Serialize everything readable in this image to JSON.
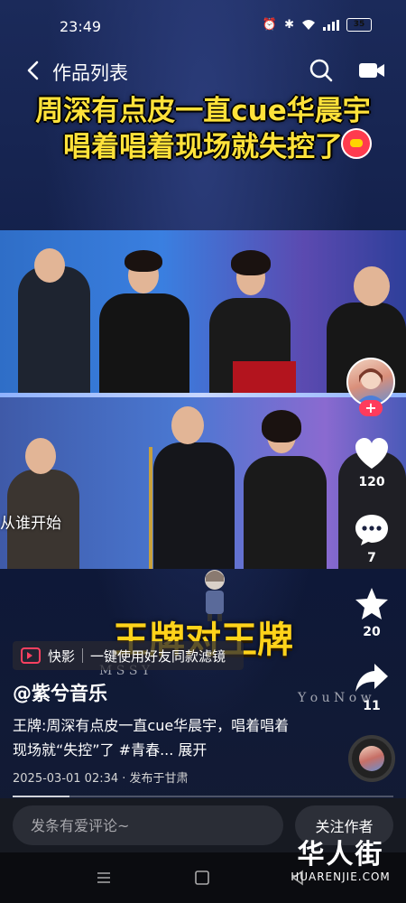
{
  "status_bar": {
    "time": "23:49",
    "battery": "35"
  },
  "top_bar": {
    "title": "作品列表"
  },
  "video": {
    "headline_line1": "周深有点皮一直cue华晨宇",
    "headline_line2": "唱着唱着现场就失控了",
    "subtitle_overlay": "从谁开始",
    "caption": "王牌对王牌"
  },
  "filter_tag": {
    "brand": "快影",
    "text": "一键使用好友同款滤镜"
  },
  "post": {
    "author": "@紫兮音乐",
    "description": "王牌:周深有点皮一直cue华晨宇，唱着唱着现场就“失控”了 #青春... ",
    "expand_label": "展开",
    "meta": "2025-03-01 02:34 · 发布于甘肃",
    "progress": 0.15
  },
  "rail": {
    "like_count": "120",
    "comment_count": "7",
    "favorite_count": "20",
    "share_count": "11",
    "follow_plus": "+"
  },
  "bottom_bar": {
    "comment_placeholder": "发条有爱评论~",
    "follow_label": "关注作者"
  },
  "watermark": {
    "cn": "华人街",
    "en": "HUARENJIE.COM"
  },
  "colors": {
    "headline": "#ffe23a",
    "caption": "#ffd31a",
    "accent": "#ff3b5c"
  }
}
